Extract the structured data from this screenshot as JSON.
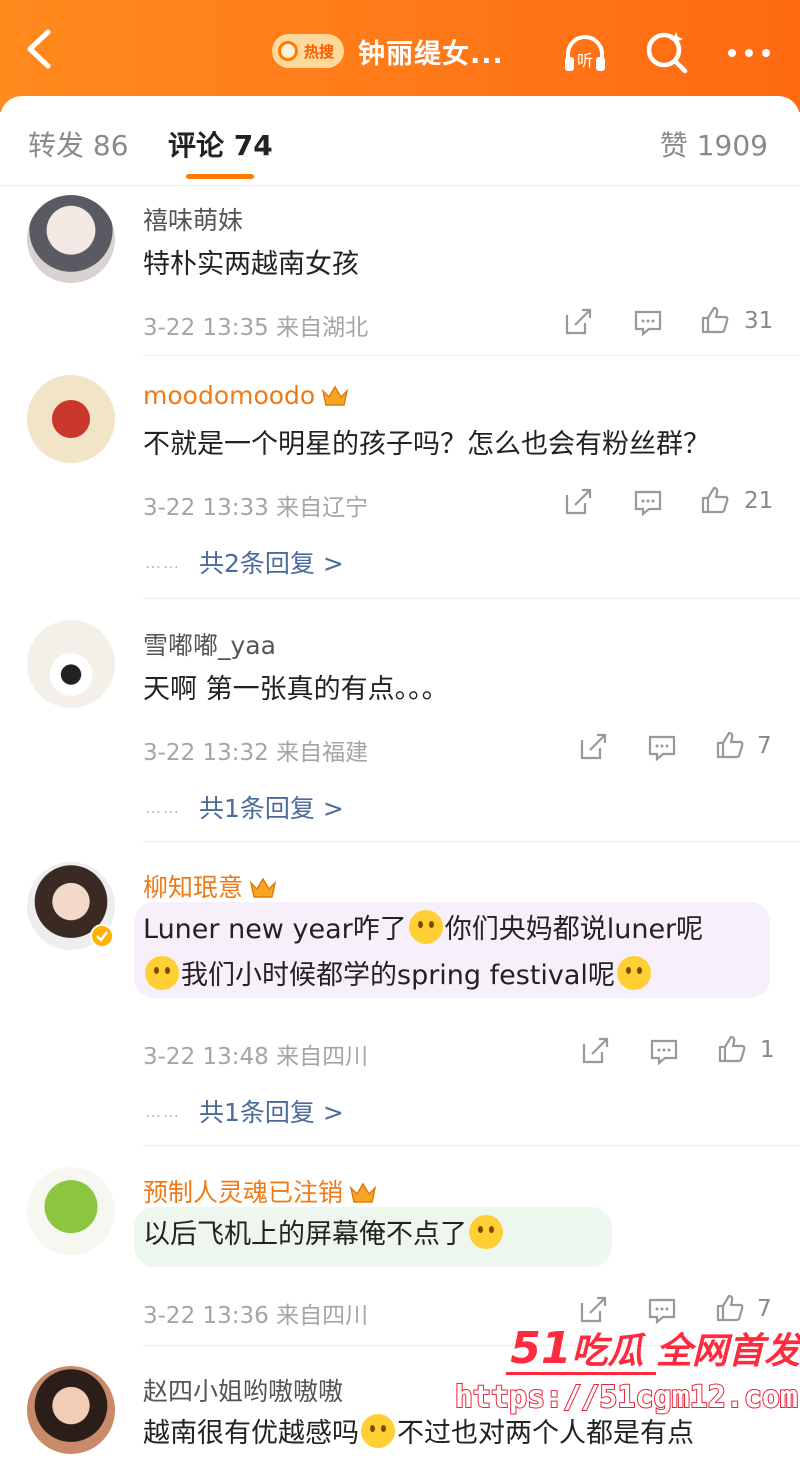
{
  "header": {
    "hot_tag": "热搜",
    "topic": "钟丽缇女...",
    "back_icon": "back-arrow-icon",
    "listen_icon": "headphones-listen-icon",
    "search_icon": "search-icon",
    "more_icon": "more-dots-icon",
    "accent": "#ff7a00"
  },
  "tabs": {
    "repost": "转发 86",
    "comments": "评论 74",
    "likes": "赞 1909"
  },
  "comments": [
    {
      "user": "禧味萌妹",
      "vip": false,
      "text_lines": [
        "特朴实两越南女孩"
      ],
      "time": "3-22 13:35",
      "location": "来自湖北",
      "likes": "31",
      "replies": ""
    },
    {
      "user": "moodomoodo",
      "vip": true,
      "text_lines": [
        "不就是一个明星的孩子吗？怎么也会有粉丝群？"
      ],
      "time": "3-22 13:33",
      "location": "来自辽宁",
      "likes": "21",
      "replies": "共2条回复 >"
    },
    {
      "user": "雪嘟嘟_yaa",
      "vip": false,
      "text_lines": [
        "天啊 第一张真的有点。。。"
      ],
      "time": "3-22 13:32",
      "location": "来自福建",
      "likes": "7",
      "replies": "共1条回复 >"
    },
    {
      "user": "柳知珉意",
      "vip": true,
      "text_lines": [
        "Luner new year咋了",
        "你们央妈都说luner呢",
        "我们小时候都学的spring festival呢"
      ],
      "time": "3-22 13:48",
      "location": "来自四川",
      "likes": "1",
      "replies": "共1条回复 >"
    },
    {
      "user": "预制人灵魂已注销",
      "vip": true,
      "text_lines": [
        "以后飞机上的屏幕俺不点了"
      ],
      "time": "3-22 13:36",
      "location": "来自四川",
      "likes": "7",
      "replies": ""
    },
    {
      "user": "赵四小姐哟嗷嗷嗷",
      "vip": false,
      "text_lines": [
        "越南很有优越感吗",
        "不过也对两个人都是有点"
      ],
      "time": "",
      "location": "",
      "likes": "",
      "replies": ""
    }
  ],
  "watermark": {
    "brand": "51",
    "slogan": "吃瓜 全网首发",
    "url": "https://51cgm12.com"
  }
}
